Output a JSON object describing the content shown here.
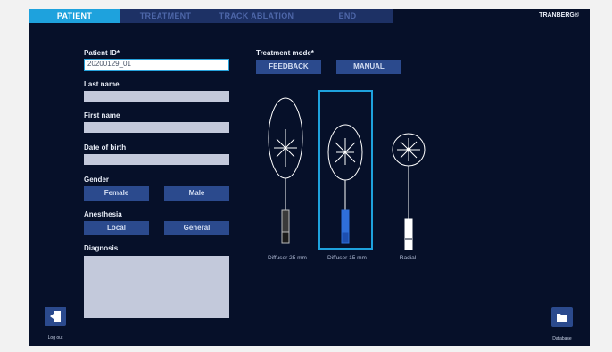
{
  "tabs": [
    {
      "label": "PATIENT"
    },
    {
      "label": "TREATMENT"
    },
    {
      "label": "TRACK ABLATION"
    },
    {
      "label": "END"
    }
  ],
  "brand": "TRANBERG®",
  "form": {
    "patient_id_label": "Patient ID*",
    "patient_id_value": "20200129_01",
    "last_name_label": "Last name",
    "first_name_label": "First name",
    "dob_label": "Date of birth",
    "gender_label": "Gender",
    "gender_options": [
      "Female",
      "Male"
    ],
    "anesthesia_label": "Anesthesia",
    "anesthesia_options": [
      "Local",
      "General"
    ],
    "diagnosis_label": "Diagnosis"
  },
  "treatment": {
    "mode_label": "Treatment mode*",
    "modes": [
      "FEEDBACK",
      "MANUAL"
    ],
    "fibers": [
      {
        "label": "Diffuser 25 mm"
      },
      {
        "label": "Diffuser 15 mm",
        "selected": true
      },
      {
        "label": "Radial"
      }
    ]
  },
  "logout_label": "Log out",
  "database_label": "Database",
  "colors": {
    "background": "#061029",
    "active_tab": "#1ea2dd",
    "tab": "#1d3165",
    "button": "#2b4a8d",
    "field": "#c3c9db",
    "accent_blue": "#2f6fd9"
  }
}
